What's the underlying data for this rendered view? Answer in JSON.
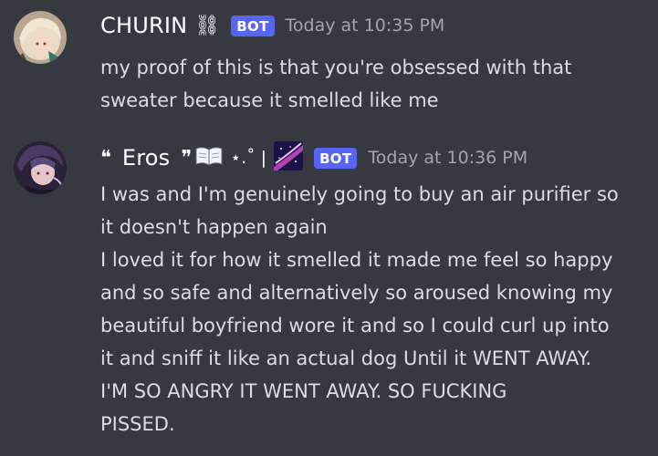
{
  "messages": [
    {
      "username": "CHURIN",
      "name_suffix": "⛓",
      "bot_tag": "BOT",
      "timestamp": "Today at 10:35 PM",
      "lines": [
        "my proof of this is that you're obsessed with that",
        "sweater because it smelled like me"
      ],
      "avatar_colors": {
        "bg": "#c9b49a",
        "hair": "#e8dcc6",
        "accent": "#3d6f6a"
      }
    },
    {
      "username": "Eros",
      "name_prefix": "❝",
      "name_suffix": "❞",
      "name_sparkle": "⋆.˚ |",
      "bot_tag": "BOT",
      "timestamp": "Today at 10:36 PM",
      "lines": [
        "I was and I'm genuinely going to buy an air purifier so",
        "it doesn't happen again",
        "I loved it for how it smelled it made me feel so happy",
        "and so safe and alternatively so aroused knowing my",
        "beautiful boyfriend wore it and so I could curl up into",
        "it and sniff it like an actual dog Until it WENT AWAY.",
        "I'M SO ANGRY IT WENT AWAY. SO FUCKING",
        "PISSED."
      ],
      "avatar_colors": {
        "bg": "#2a2236",
        "hair": "#5a4a7a",
        "accent": "#d9b8c4"
      }
    }
  ],
  "colors": {
    "background": "#36393f",
    "bot_badge": "#5865f2",
    "text": "#dcddde",
    "timestamp": "#a3a6aa"
  },
  "icons": [
    "book-emoji-icon",
    "galaxy-emoji-icon"
  ]
}
